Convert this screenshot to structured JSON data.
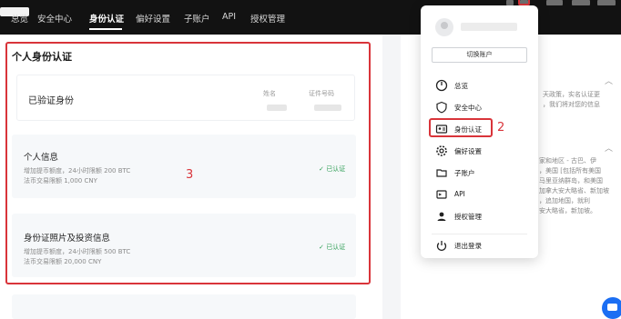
{
  "topnav": {
    "tabs": [
      {
        "label": "总览"
      },
      {
        "label": "安全中心"
      },
      {
        "label": "身份认证",
        "active": true
      },
      {
        "label": "偏好设置"
      },
      {
        "label": "子账户"
      },
      {
        "label": "API"
      },
      {
        "label": "授权管理"
      }
    ]
  },
  "main": {
    "title": "个人身份认证",
    "verified": {
      "label": "已验证身份",
      "col_name": "姓名",
      "col_id": "证件号码"
    },
    "personal_info": {
      "title": "个人信息",
      "line1": "增加提币额度，24小时限额 200 BTC",
      "line2": "法币交易限额 1,000 CNY",
      "status": "已认证"
    },
    "id_photo": {
      "title": "身份证照片及投资信息",
      "line1": "增加提币额度，24小时限额 500 BTC",
      "line2": "法币交易限额 20,000 CNY",
      "status": "已认证"
    }
  },
  "annotations": {
    "label_main": "3",
    "label_menu": "2",
    "color": "#d9343a"
  },
  "right": {
    "lines": [
      "天政策，实名认证更",
      "，我们将对您的信息"
    ],
    "section2_lines": [
      "家和地区 - 古巴、伊",
      "，美国 [包括所有美国",
      "马里亚纳群岛，和美国",
      "加拿大安大略省、新加坡",
      "，追加地国，就利",
      "安大略省，新加坡。"
    ]
  },
  "dropdown": {
    "switch_label": "切换账户",
    "items": [
      {
        "icon": "dashboard-icon",
        "label": "总览"
      },
      {
        "icon": "shield-icon",
        "label": "安全中心"
      },
      {
        "icon": "id-card-icon",
        "label": "身份认证"
      },
      {
        "icon": "gear-icon",
        "label": "偏好设置"
      },
      {
        "icon": "folder-icon",
        "label": "子账户"
      },
      {
        "icon": "api-icon",
        "label": "API"
      },
      {
        "icon": "user-icon",
        "label": "授权管理"
      }
    ],
    "logout_label": "退出登录"
  },
  "colors": {
    "nav_bg": "#121212",
    "accent_red": "#d9343a",
    "status_green": "#2f9e55",
    "chat_blue": "#1b6ef3"
  }
}
